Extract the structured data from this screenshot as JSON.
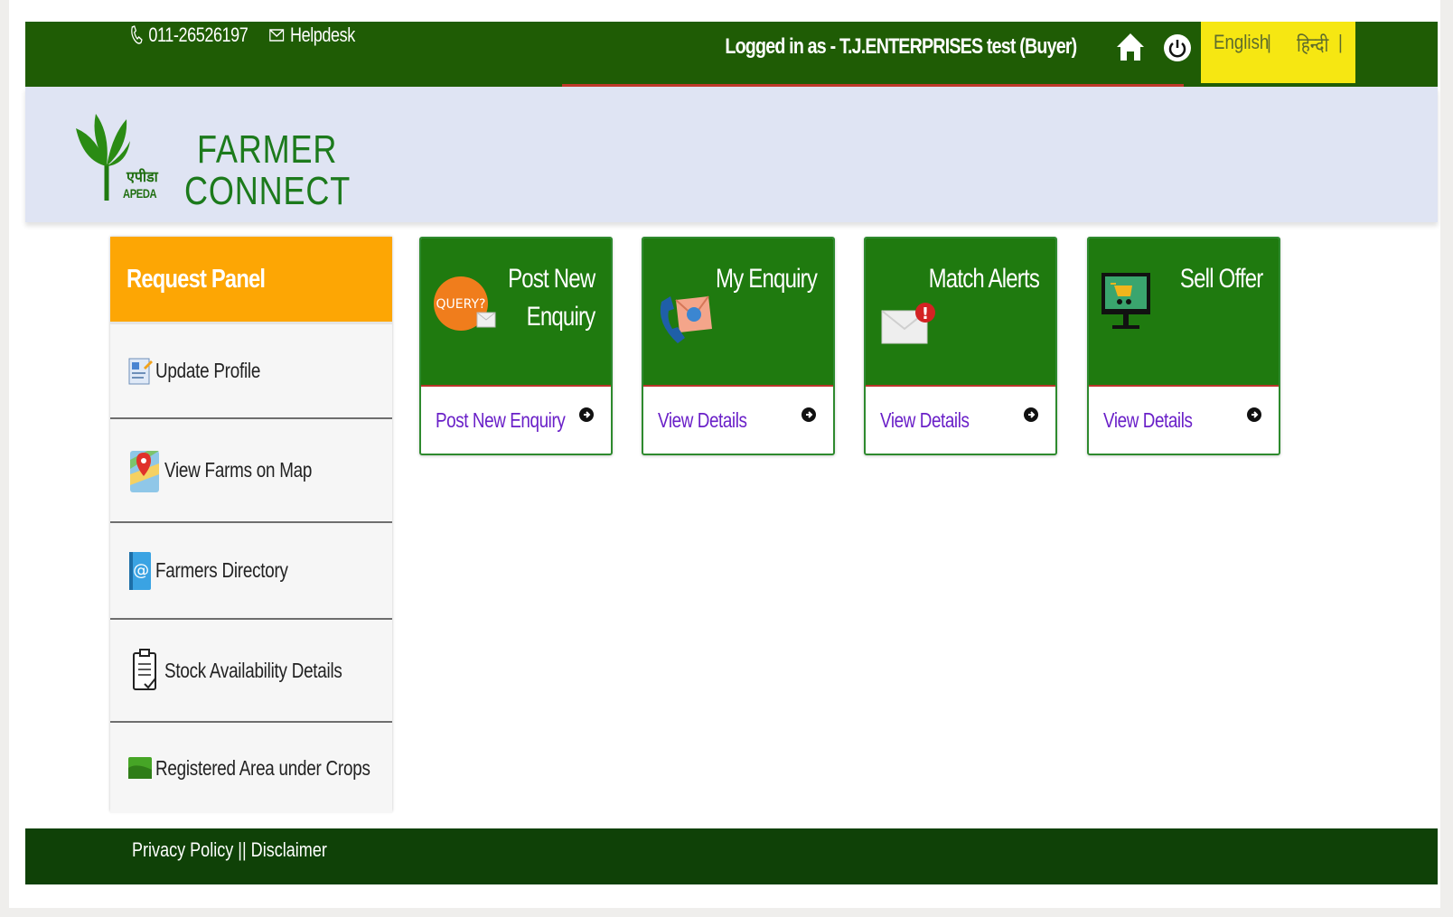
{
  "topbar": {
    "phone": "011-26526197",
    "helpdesk": "Helpdesk",
    "logged_in": "Logged in as - T.J.ENTERPRISES test (Buyer)",
    "lang_english": "English",
    "lang_hindi": "हिन्दी",
    "lang_separator": "|",
    "colors": {
      "bar": "#1f5c05",
      "lang_box": "#f6e712"
    }
  },
  "header": {
    "logo_hindi": "एपीडा",
    "logo_apeda": "APEDA",
    "brand_line1": "FARMER",
    "brand_line2": "CONNECT"
  },
  "sidebar": {
    "title": "Request Panel",
    "items": [
      {
        "label": "Update Profile",
        "icon": "profile-icon"
      },
      {
        "label": "View Farms on Map",
        "icon": "map-icon"
      },
      {
        "label": "Farmers Directory",
        "icon": "directory-icon"
      },
      {
        "label": "Stock Availability Details",
        "icon": "clipboard-icon"
      },
      {
        "label": "Registered Area under Crops",
        "icon": "crop-area-icon"
      }
    ]
  },
  "cards": [
    {
      "title_line1": "Post New",
      "title_line2": "Enquiry",
      "link": "Post New Enquiry",
      "icon": "query-icon",
      "icon_text": "QUERY?"
    },
    {
      "title_line1": "My Enquiry",
      "title_line2": "",
      "link": "View Details",
      "icon": "phone-mail-icon"
    },
    {
      "title_line1": "Match Alerts",
      "title_line2": "",
      "link": "View Details",
      "icon": "alert-mail-icon"
    },
    {
      "title_line1": "Sell Offer",
      "title_line2": "",
      "link": "View Details",
      "icon": "monitor-cart-icon"
    }
  ],
  "footer": {
    "privacy": "Privacy Policy",
    "separator": " || ",
    "disclaimer": "Disclaimer"
  }
}
